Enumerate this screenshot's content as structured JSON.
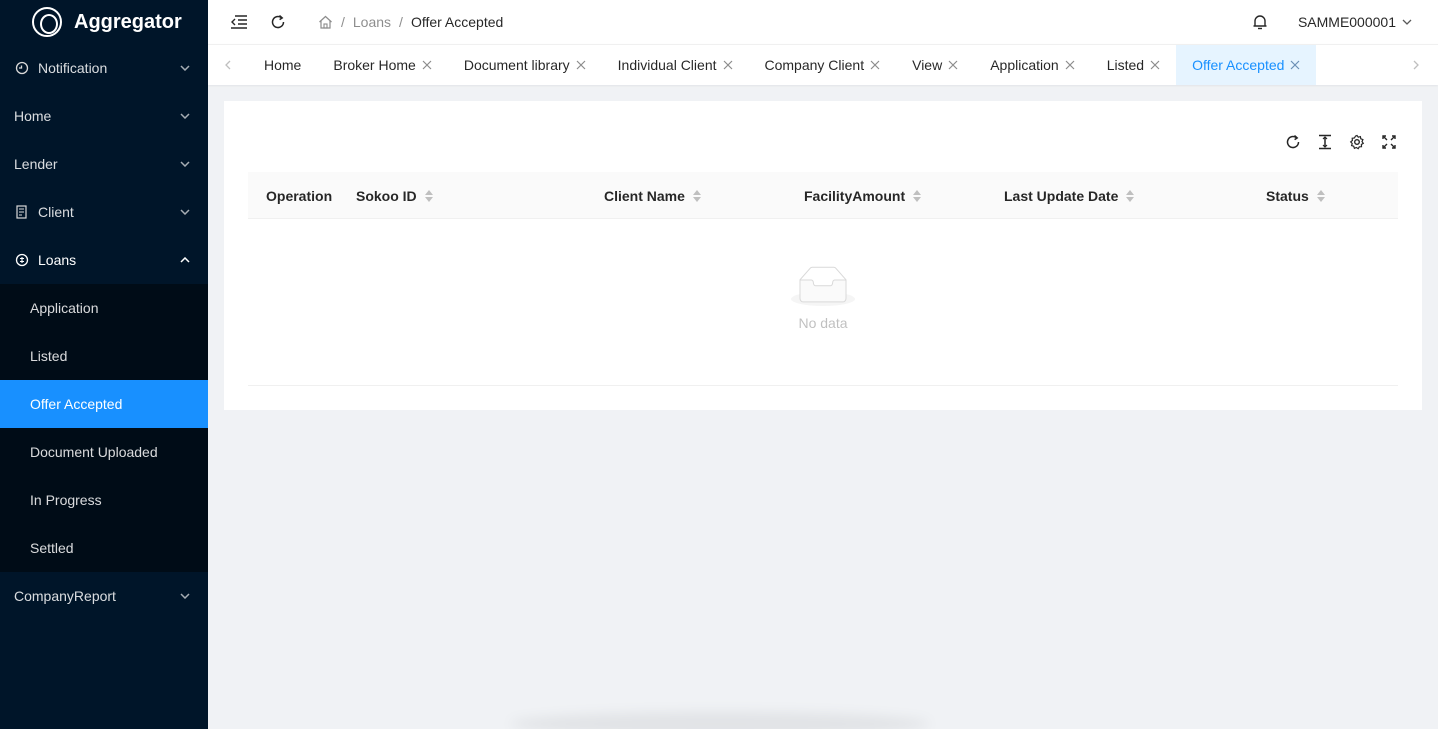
{
  "app": {
    "title": "Aggregator"
  },
  "sidebar": {
    "items": [
      {
        "label": "Notification",
        "icon": "notification-icon"
      },
      {
        "label": "Home"
      },
      {
        "label": "Lender"
      },
      {
        "label": "Client",
        "icon": "client-icon"
      },
      {
        "label": "Loans",
        "icon": "loans-icon",
        "expanded": true
      },
      {
        "label": "CompanyReport"
      }
    ],
    "loans_sub": [
      {
        "label": "Application"
      },
      {
        "label": "Listed"
      },
      {
        "label": "Offer Accepted",
        "active": true
      },
      {
        "label": "Document Uploaded"
      },
      {
        "label": "In Progress"
      },
      {
        "label": "Settled"
      }
    ]
  },
  "header": {
    "breadcrumb": {
      "sep1": "/",
      "level1": "Loans",
      "sep2": "/",
      "current": "Offer Accepted"
    },
    "user": "SAMME000001"
  },
  "tabs": [
    {
      "label": "Home"
    },
    {
      "label": "Broker Home"
    },
    {
      "label": "Document library"
    },
    {
      "label": "Individual Client"
    },
    {
      "label": "Company Client"
    },
    {
      "label": "View"
    },
    {
      "label": "Application"
    },
    {
      "label": "Listed"
    },
    {
      "label": "Offer Accepted",
      "active": true
    }
  ],
  "table": {
    "columns": [
      "Operation",
      "Sokoo ID",
      "Client Name",
      "FacilityAmount",
      "Last Update Date",
      "Status"
    ],
    "empty_text": "No data"
  },
  "colors": {
    "sidebar": "#001529",
    "submenu": "#000c17",
    "accent": "#1890ff",
    "page_bg": "#f0f2f5"
  }
}
